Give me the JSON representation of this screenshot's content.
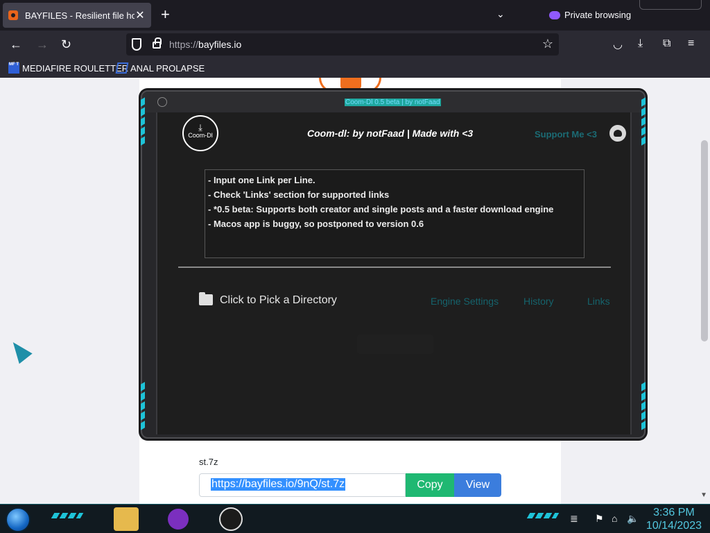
{
  "browser": {
    "tab_title": "BAYFILES - Resilient file hosting",
    "tab_close": "✕",
    "new_tab": "+",
    "tab_list": "⌄",
    "private_label": "Private browsing",
    "url_scheme": "https://",
    "url_host": "bayfiles.io",
    "bookmarks": [
      {
        "label": "MEDIAFIRE ROULETTER",
        "icon_text": "MF T"
      },
      {
        "label": "ANAL PROLAPSE"
      }
    ]
  },
  "app": {
    "window_title": "Coom-Dl 0.5 beta | by notFaad",
    "logo_text": "Coom-Dl",
    "header": "Coom-dl:  by notFaad  |  Made with <3",
    "support": "Support Me <3",
    "notes": [
      "- Input one Link per Line.",
      "- Check 'Links' section for supported links",
      "- *0.5 beta: Supports both creator and single posts and a faster download engine",
      "- Macos app is buggy, so postponed to version 0.6"
    ],
    "pick_directory": "Click to Pick a Directory",
    "nav": {
      "engine_settings": "Engine Settings",
      "history": "History",
      "links": "Links"
    }
  },
  "page": {
    "filename": "st.7z",
    "link": "https://bayfiles.io/9nQ/st.7z",
    "copy_label": "Copy",
    "view_label": "View"
  },
  "taskbar": {
    "time": "3:36 PM",
    "date": "10/14/2023"
  },
  "colors": {
    "accent_cyan": "#1ec3d8",
    "copy_green": "#1fb872",
    "view_blue": "#3b7ddd",
    "orange": "#ef6e1e"
  }
}
